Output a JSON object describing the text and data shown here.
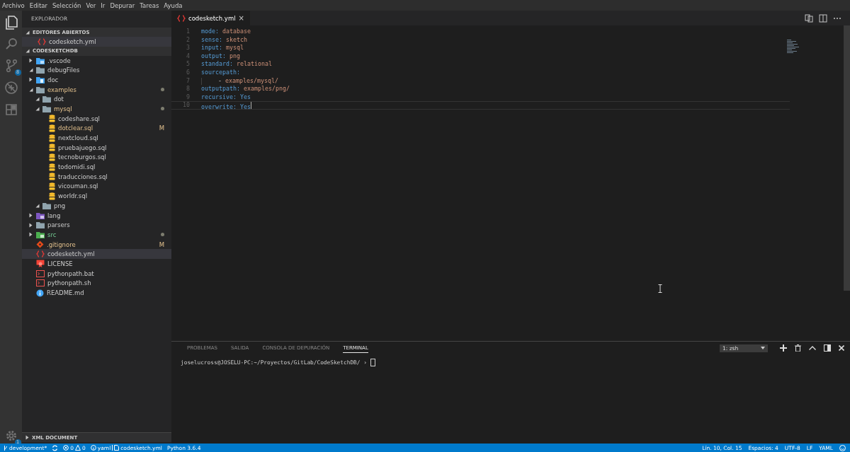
{
  "menu": [
    "Archivo",
    "Editar",
    "Selección",
    "Ver",
    "Ir",
    "Depurar",
    "Tareas",
    "Ayuda"
  ],
  "activity_bar": {
    "items": [
      {
        "kind": "files",
        "selected": true
      },
      {
        "kind": "search",
        "selected": false
      },
      {
        "kind": "git",
        "selected": false,
        "badge": "8"
      },
      {
        "kind": "debug",
        "selected": false
      },
      {
        "kind": "extensions",
        "selected": false
      }
    ],
    "settings_badge": "1"
  },
  "sidebar": {
    "title": "EXPLORADOR",
    "open_editors": {
      "title": "EDITORES ABIERTOS",
      "expanded": true,
      "items": [
        {
          "name": "codesketch.yml",
          "kind": "yaml",
          "selected": true
        }
      ]
    },
    "project": {
      "title": "CODESKETCHDB",
      "expanded": true,
      "tree": [
        {
          "name": ".vscode",
          "kind": "folder-vscode",
          "expanded": false,
          "modified": false,
          "untracked": false
        },
        {
          "name": "debugFiles",
          "kind": "folder",
          "expanded": true,
          "modified": false,
          "untracked": false
        },
        {
          "name": "doc",
          "kind": "folder-doc",
          "expanded": false,
          "modified": false,
          "untracked": false
        },
        {
          "name": "examples",
          "kind": "folder",
          "expanded": true,
          "modified": true,
          "untracked": false,
          "children": [
            {
              "name": "dot",
              "kind": "folder",
              "expanded": true,
              "modified": false,
              "untracked": false
            },
            {
              "name": "mysql",
              "kind": "folder",
              "expanded": true,
              "modified": true,
              "untracked": false,
              "children": [
                {
                  "name": "codeshare.sql",
                  "kind": "sql",
                  "modified": false,
                  "untracked": false
                },
                {
                  "name": "dotclear.sql",
                  "kind": "sql",
                  "modified": true,
                  "untracked": false,
                  "badge": "M"
                },
                {
                  "name": "nextcloud.sql",
                  "kind": "sql",
                  "modified": false,
                  "untracked": false
                },
                {
                  "name": "pruebajuego.sql",
                  "kind": "sql",
                  "modified": false,
                  "untracked": false
                },
                {
                  "name": "tecnoburgos.sql",
                  "kind": "sql",
                  "modified": false,
                  "untracked": false
                },
                {
                  "name": "todomidi.sql",
                  "kind": "sql",
                  "modified": false,
                  "untracked": false
                },
                {
                  "name": "traducciones.sql",
                  "kind": "sql",
                  "modified": false,
                  "untracked": false
                },
                {
                  "name": "vicouman.sql",
                  "kind": "sql",
                  "modified": false,
                  "untracked": false
                },
                {
                  "name": "worldr.sql",
                  "kind": "sql",
                  "modified": false,
                  "untracked": false
                }
              ]
            },
            {
              "name": "png",
              "kind": "folder",
              "expanded": true,
              "modified": false,
              "untracked": false
            }
          ]
        },
        {
          "name": "lang",
          "kind": "folder-lang",
          "expanded": false,
          "modified": false,
          "untracked": false
        },
        {
          "name": "parsers",
          "kind": "folder",
          "expanded": false,
          "modified": false,
          "untracked": false
        },
        {
          "name": "src",
          "kind": "folder-src",
          "expanded": false,
          "modified": false,
          "untracked": true
        },
        {
          "name": ".gitignore",
          "kind": "git",
          "modified": true,
          "untracked": false,
          "badge": "M"
        },
        {
          "name": "codesketch.yml",
          "kind": "yaml",
          "modified": false,
          "untracked": false,
          "selected": true
        },
        {
          "name": "LICENSE",
          "kind": "license",
          "modified": false,
          "untracked": false
        },
        {
          "name": "pythonpath.bat",
          "kind": "shell",
          "modified": false,
          "untracked": false
        },
        {
          "name": "pythonpath.sh",
          "kind": "shell",
          "modified": false,
          "untracked": false
        },
        {
          "name": "README.md",
          "kind": "info",
          "modified": false,
          "untracked": false
        }
      ]
    },
    "outline": {
      "title": "XML DOCUMENT",
      "expanded": false
    }
  },
  "editor": {
    "tab": {
      "name": "codesketch.yml",
      "close": "×",
      "selected": true
    },
    "lines": [
      {
        "number": "1",
        "kind": "pair",
        "key": "mode:",
        "value": "database",
        "keyword": false,
        "current": false
      },
      {
        "number": "2",
        "kind": "pair",
        "key": "sense:",
        "value": "sketch",
        "keyword": false,
        "current": false
      },
      {
        "number": "3",
        "kind": "pair",
        "key": "input:",
        "value": "mysql",
        "keyword": false,
        "current": false
      },
      {
        "number": "4",
        "kind": "pair",
        "key": "output:",
        "value": "png",
        "keyword": false,
        "current": false
      },
      {
        "number": "5",
        "kind": "pair",
        "key": "standard:",
        "value": "relational",
        "keyword": false,
        "current": false
      },
      {
        "number": "6",
        "kind": "pair",
        "key": "sourcepath:",
        "current": false
      },
      {
        "number": "7",
        "kind": "list-item",
        "marker": "-",
        "value": "examples/mysql/",
        "keyword": false,
        "current": false
      },
      {
        "number": "8",
        "kind": "pair",
        "key": "outputpath:",
        "value": "examples/png/",
        "keyword": false,
        "current": false
      },
      {
        "number": "9",
        "kind": "pair",
        "key": "recursive:",
        "value": "Yes",
        "keyword": true,
        "current": false
      },
      {
        "number": "10",
        "kind": "pair",
        "key": "overwrite:",
        "value": "Yes",
        "keyword": true,
        "current": true
      }
    ]
  },
  "panel": {
    "tabs": [
      {
        "label": "PROBLEMAS",
        "selected": false
      },
      {
        "label": "SALIDA",
        "selected": false
      },
      {
        "label": "CONSOLA DE DEPURACIÓN",
        "selected": false
      },
      {
        "label": "TERMINAL",
        "selected": true
      }
    ],
    "terminal_select": "1: zsh",
    "prompt": "joselucross@JOSELU-PC:~/Proyectos/GitLab/CodeSketchDB/ › "
  },
  "status_bar": {
    "branch": "development*",
    "errors": "0",
    "warnings": "0",
    "language_info": "yaml",
    "file": "codesketch.yml",
    "python": "Python 3.6.4",
    "right": [
      "Lín. 10, Col. 15",
      "Espacios: 4",
      "UTF-8",
      "LF",
      "YAML"
    ]
  }
}
